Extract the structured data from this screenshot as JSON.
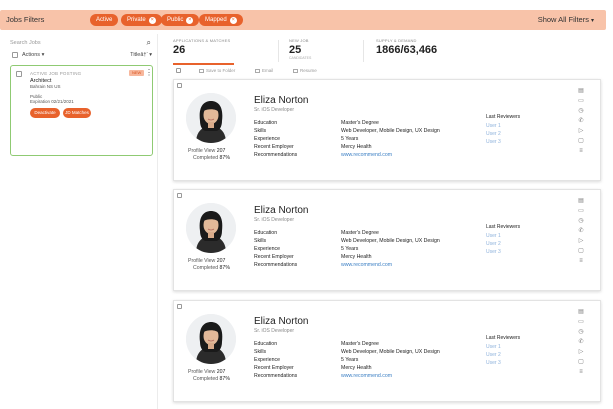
{
  "topbar": {
    "title": "Jobs Filters",
    "chips": [
      "Active",
      "Private",
      "Public",
      "Mapped"
    ],
    "show_all": "Show All Filters"
  },
  "sidebar": {
    "search_placeholder": "Search Jobs",
    "actions_label": "Actions",
    "sort_label": "Titleâ†‘",
    "job": {
      "kicker": "ACTIVE JOB POSTING",
      "badge": "NEW",
      "title": "Architect",
      "location": "Bahrain NS US",
      "visibility": "Public",
      "expiration": "Expiration 02/21/2021",
      "buttons": [
        "Deactivate",
        "JD Matches"
      ]
    }
  },
  "main": {
    "stats": [
      {
        "label": "APPLICATIONS & MATCHES",
        "value": "26",
        "sub": ""
      },
      {
        "label": "NEW JOB",
        "value": "25",
        "sub": "CANDIDATES"
      },
      {
        "label": "SUPPLY & DEMAND",
        "value": "1866/63,466",
        "sub": ""
      }
    ],
    "tools": [
      "Save to Folder",
      "Email",
      "Resume"
    ],
    "candidates": [
      {
        "name": "Eliza Norton",
        "role": "Sr. iOS Developer",
        "fields": [
          {
            "label": "Education",
            "value": "Master's Degree"
          },
          {
            "label": "Skills",
            "value": "Web Developer, Mobile Design, UX Design"
          },
          {
            "label": "Experience",
            "value": "5 Years"
          },
          {
            "label": "Recent Employer",
            "value": "Mercy Health"
          },
          {
            "label": "Recommendations",
            "value": "www.recommend.com"
          }
        ],
        "profile_view_label": "Profile View",
        "profile_view": "207",
        "completed_label": "Completed",
        "completed": "87%",
        "reviewers_title": "Last Reviewers",
        "reviewers": [
          "User 1",
          "User 2",
          "User 3"
        ]
      },
      {
        "name": "Eliza Norton",
        "role": "Sr. iOS Developer",
        "fields": [
          {
            "label": "Education",
            "value": "Master's Degree"
          },
          {
            "label": "Skills",
            "value": "Web Developer, Mobile Design, UX Design"
          },
          {
            "label": "Experience",
            "value": "5 Years"
          },
          {
            "label": "Recent Employer",
            "value": "Mercy Health"
          },
          {
            "label": "Recommendations",
            "value": "www.recommend.com"
          }
        ],
        "profile_view_label": "Profile View",
        "profile_view": "207",
        "completed_label": "Completed",
        "completed": "87%",
        "reviewers_title": "Last Reviewers",
        "reviewers": [
          "User 1",
          "User 2",
          "User 3"
        ]
      },
      {
        "name": "Eliza Norton",
        "role": "Sr. iOS Developer",
        "fields": [
          {
            "label": "Education",
            "value": "Master's Degree"
          },
          {
            "label": "Skills",
            "value": "Web Developer, Mobile Design, UX Design"
          },
          {
            "label": "Experience",
            "value": "5 Years"
          },
          {
            "label": "Recent Employer",
            "value": "Mercy Health"
          },
          {
            "label": "Recommendations",
            "value": "www.recommend.com"
          }
        ],
        "profile_view_label": "Profile View",
        "profile_view": "207",
        "completed_label": "Completed",
        "completed": "87%",
        "reviewers_title": "Last Reviewers",
        "reviewers": [
          "User 1",
          "User 2",
          "User 3"
        ]
      }
    ]
  },
  "colors": {
    "accent": "#e8622c",
    "topbar": "#f8c3a9",
    "selected_border": "#8fca73",
    "link": "#3b7fc4"
  },
  "icons": [
    "search-icon",
    "kebab-menu-icon",
    "folder-icon",
    "email-icon",
    "resume-icon",
    "chevron-down-icon",
    "close-icon"
  ]
}
